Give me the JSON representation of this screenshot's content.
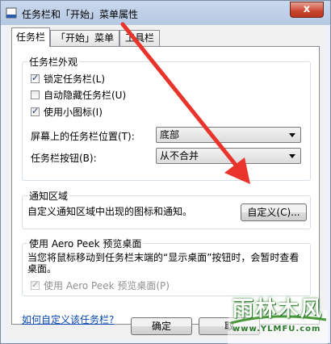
{
  "window": {
    "title": "任务栏和「开始」菜单属性",
    "close_label": "x"
  },
  "tabs": [
    {
      "label": "任务栏",
      "active": true
    },
    {
      "label": "「开始」菜单",
      "active": false
    },
    {
      "label": "工具栏",
      "active": false
    }
  ],
  "appearance": {
    "group_label": "任务栏外观",
    "lock": {
      "label": "锁定任务栏(L)",
      "checked": true
    },
    "autohide": {
      "label": "自动隐藏任务栏(U)",
      "checked": false
    },
    "small_icons": {
      "label": "使用小图标(I)",
      "checked": true
    },
    "location_label": "屏幕上的任务栏位置(T):",
    "location_value": "底部",
    "buttons_label": "任务栏按钮(B):",
    "buttons_value": "从不合并"
  },
  "notification": {
    "group_label": "通知区域",
    "description": "自定义通知区域中出现的图标和通知。",
    "customize_button": "自定义(C)..."
  },
  "aero_peek": {
    "group_label": "使用 Aero Peek 预览桌面",
    "description": "当您将鼠标移动到任务栏末端的“显示桌面”按钮时，会暂时查看桌面。",
    "checkbox": {
      "label": "使用 Aero Peek 预览桌面(P)",
      "checked": true,
      "disabled": true
    }
  },
  "help_link": "如何自定义该任务栏?",
  "buttons": {
    "ok": "确定",
    "cancel": "取"
  },
  "watermark": {
    "text": "雨林木风",
    "url": "www.YLMFU.com"
  },
  "colors": {
    "annotation_arrow": "#e8342a",
    "link": "#0645ad",
    "watermark_green": "#2b7a2b"
  }
}
